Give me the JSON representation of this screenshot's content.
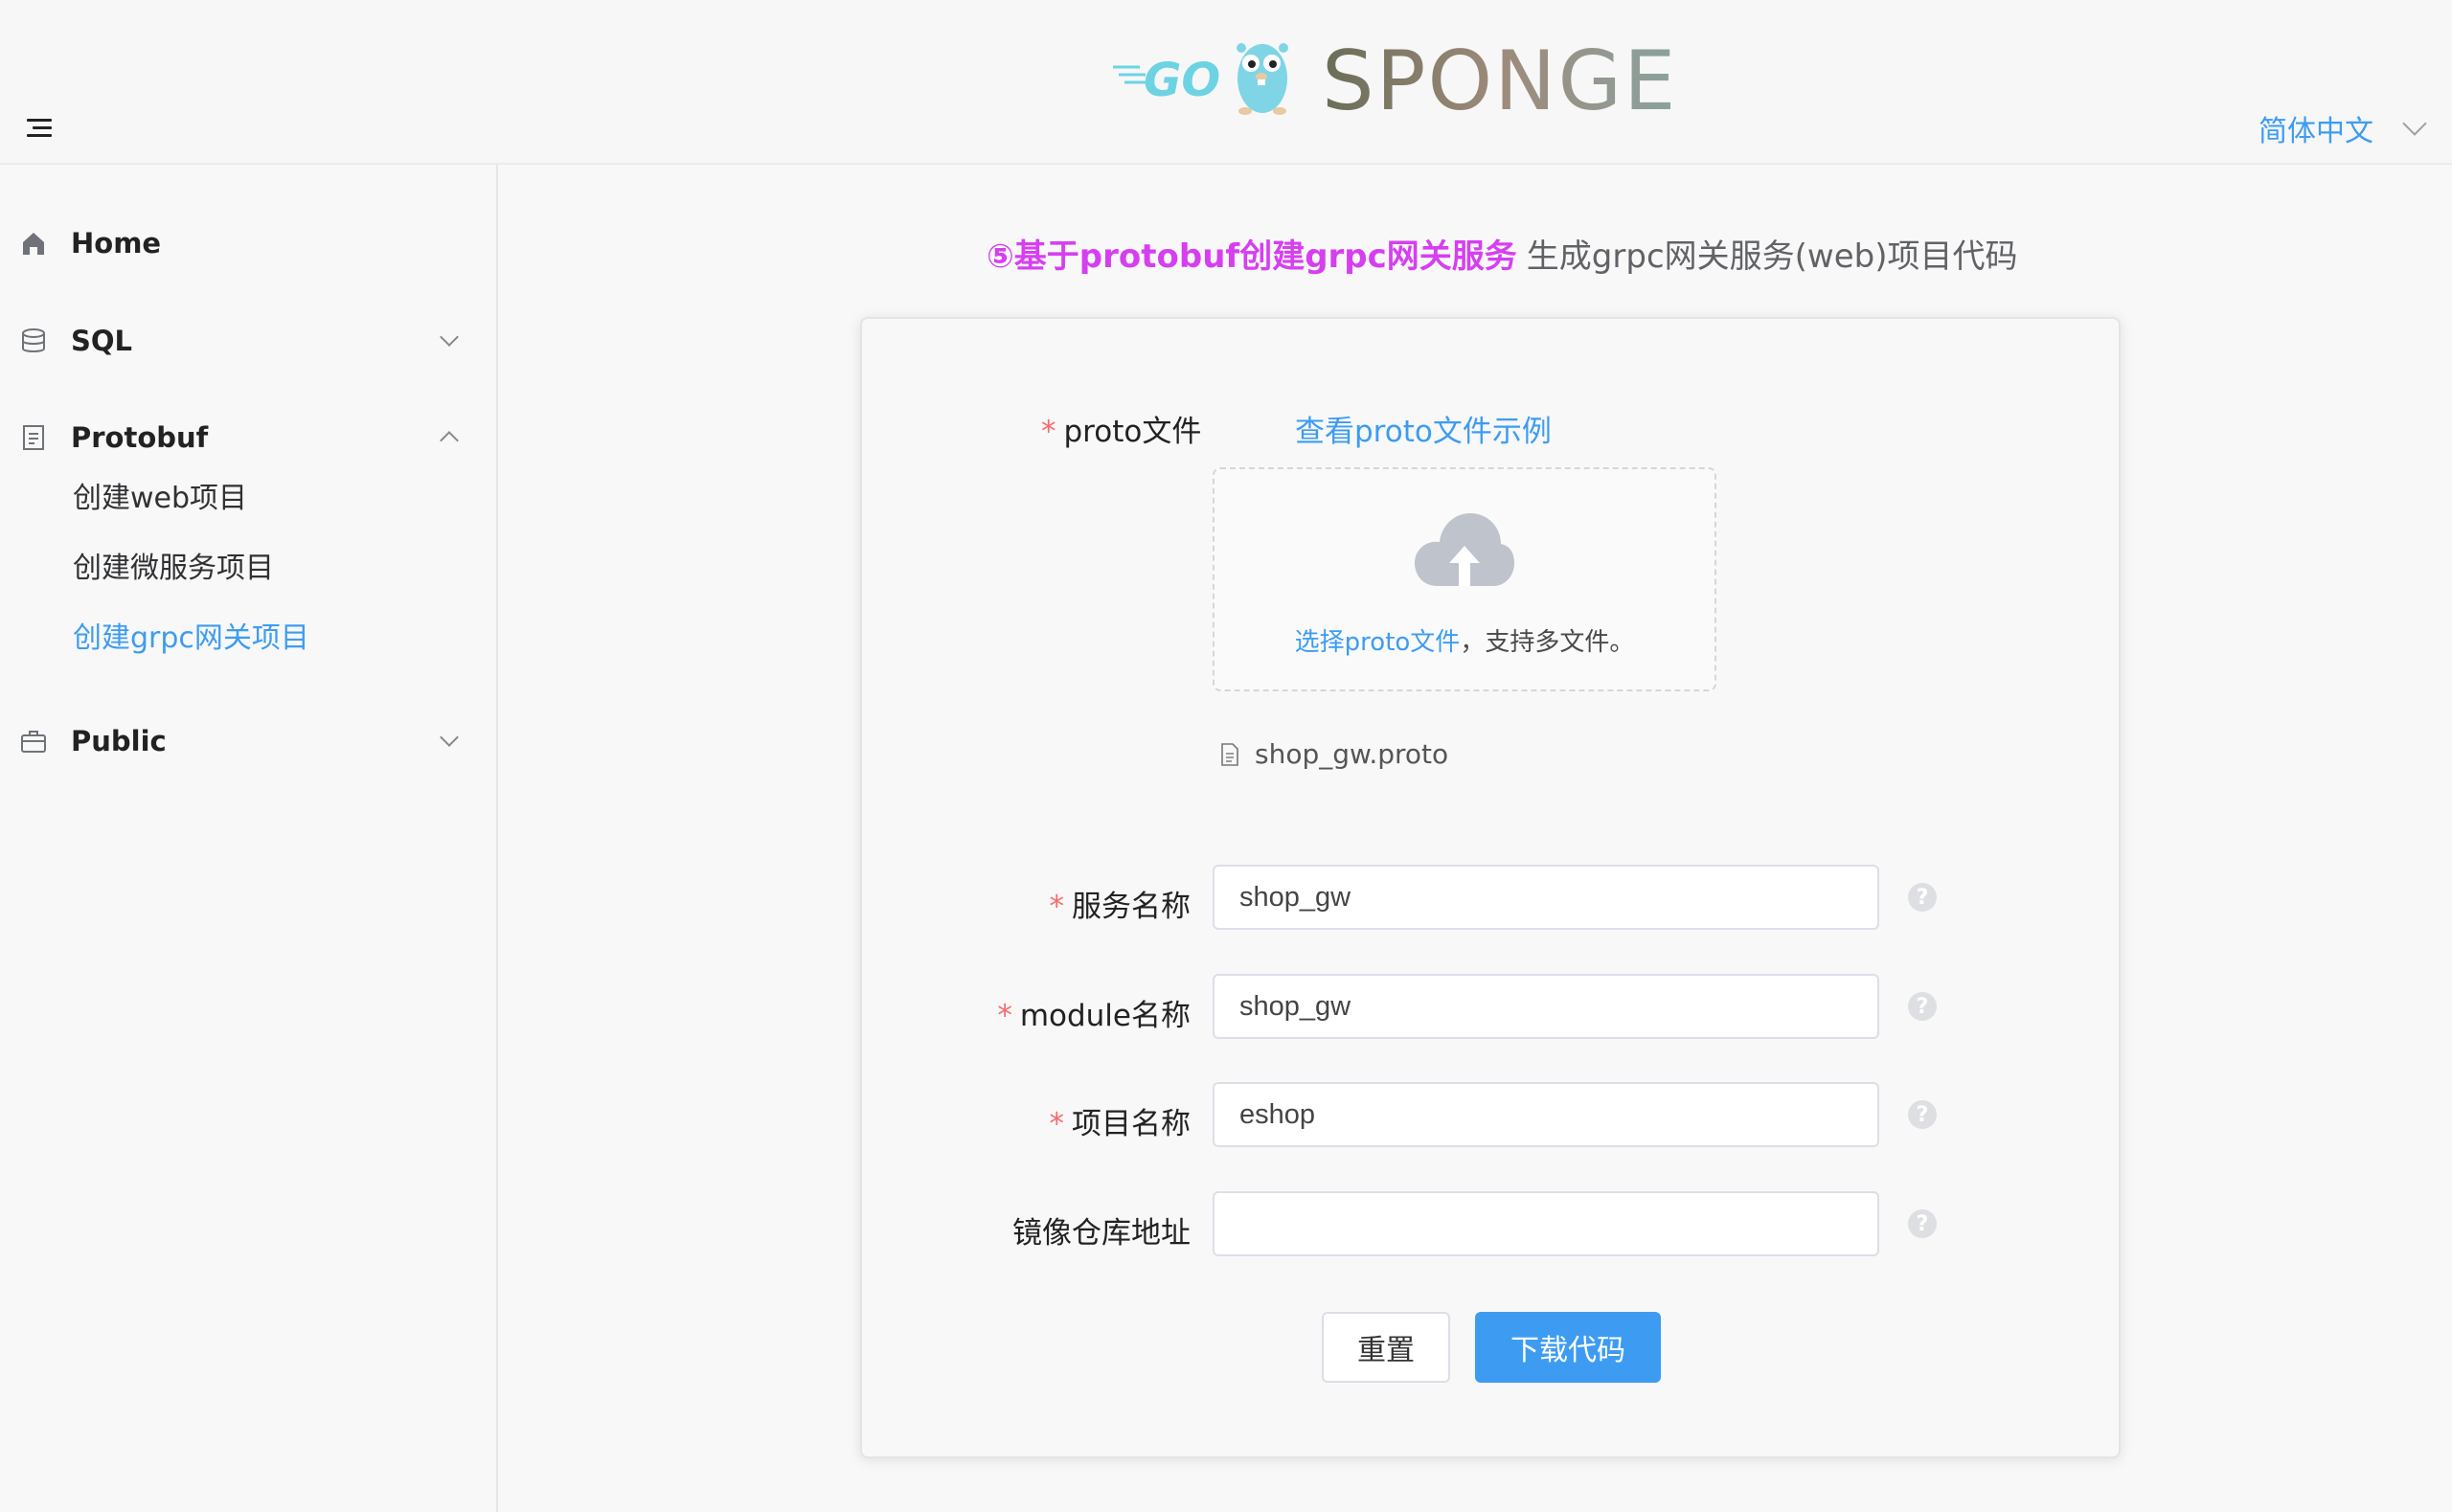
{
  "header": {
    "logo_go": "GO",
    "logo_text": "SPONGE",
    "language": "简体中文"
  },
  "sidebar": {
    "items": [
      {
        "label": "Home"
      },
      {
        "label": "SQL"
      },
      {
        "label": "Protobuf"
      },
      {
        "label": "Public"
      }
    ],
    "protobuf_sub": [
      {
        "label": "创建web项目"
      },
      {
        "label": "创建微服务项目"
      },
      {
        "label": "创建grpc网关项目",
        "active": true
      }
    ]
  },
  "main": {
    "title_accent": "⑤基于protobuf创建grpc网关服务",
    "title_rest": "生成grpc网关服务(web)项目代码"
  },
  "form": {
    "proto_label": "proto文件",
    "proto_example_link": "查看proto文件示例",
    "upload_link": "选择proto文件",
    "upload_rest": "，支持多文件。",
    "uploaded_file": "shop_gw.proto",
    "service_name_label": "服务名称",
    "service_name_value": "shop_gw",
    "module_name_label": "module名称",
    "module_name_value": "shop_gw",
    "project_name_label": "项目名称",
    "project_name_value": "eshop",
    "registry_label": "镜像仓库地址",
    "registry_value": "",
    "help_symbol": "?",
    "reset_button": "重置",
    "download_button": "下载代码"
  },
  "colors": {
    "accent": "#3d9cf2",
    "title_accent": "#d63ff0",
    "required": "#f56c6c"
  }
}
